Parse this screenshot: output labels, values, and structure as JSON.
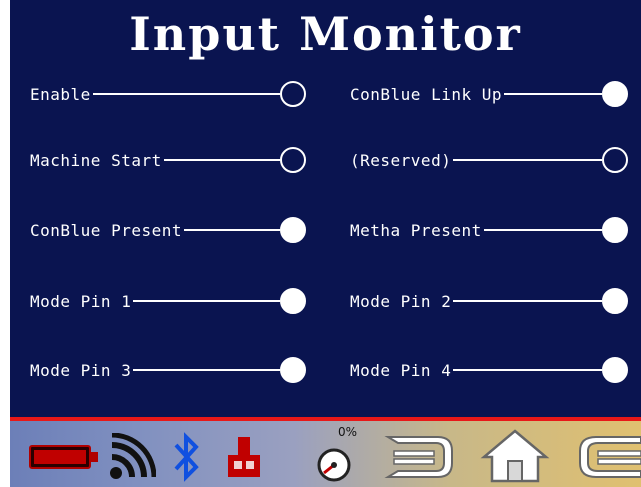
{
  "title": "Input Monitor",
  "inputs": [
    {
      "label": "Enable",
      "state": "off"
    },
    {
      "label": "ConBlue Link Up",
      "state": "on"
    },
    {
      "label": "Machine Start",
      "state": "off"
    },
    {
      "label": "(Reserved)",
      "state": "off"
    },
    {
      "label": "ConBlue Present",
      "state": "on"
    },
    {
      "label": "Metha Present",
      "state": "on"
    },
    {
      "label": "Mode Pin 1",
      "state": "on"
    },
    {
      "label": "Mode Pin 2",
      "state": "on"
    },
    {
      "label": "Mode Pin 3",
      "state": "on"
    },
    {
      "label": "Mode Pin 4",
      "state": "on"
    }
  ],
  "taskbar": {
    "speed_label": "0%",
    "icons": [
      "battery-icon",
      "signal-icon",
      "bluetooth-icon",
      "device-icon",
      "speedometer-icon",
      "menu-icon",
      "home-icon",
      "back-icon"
    ]
  },
  "colors": {
    "background": "#0a1450",
    "foreground": "#ffffff",
    "accent": "#e81818"
  }
}
